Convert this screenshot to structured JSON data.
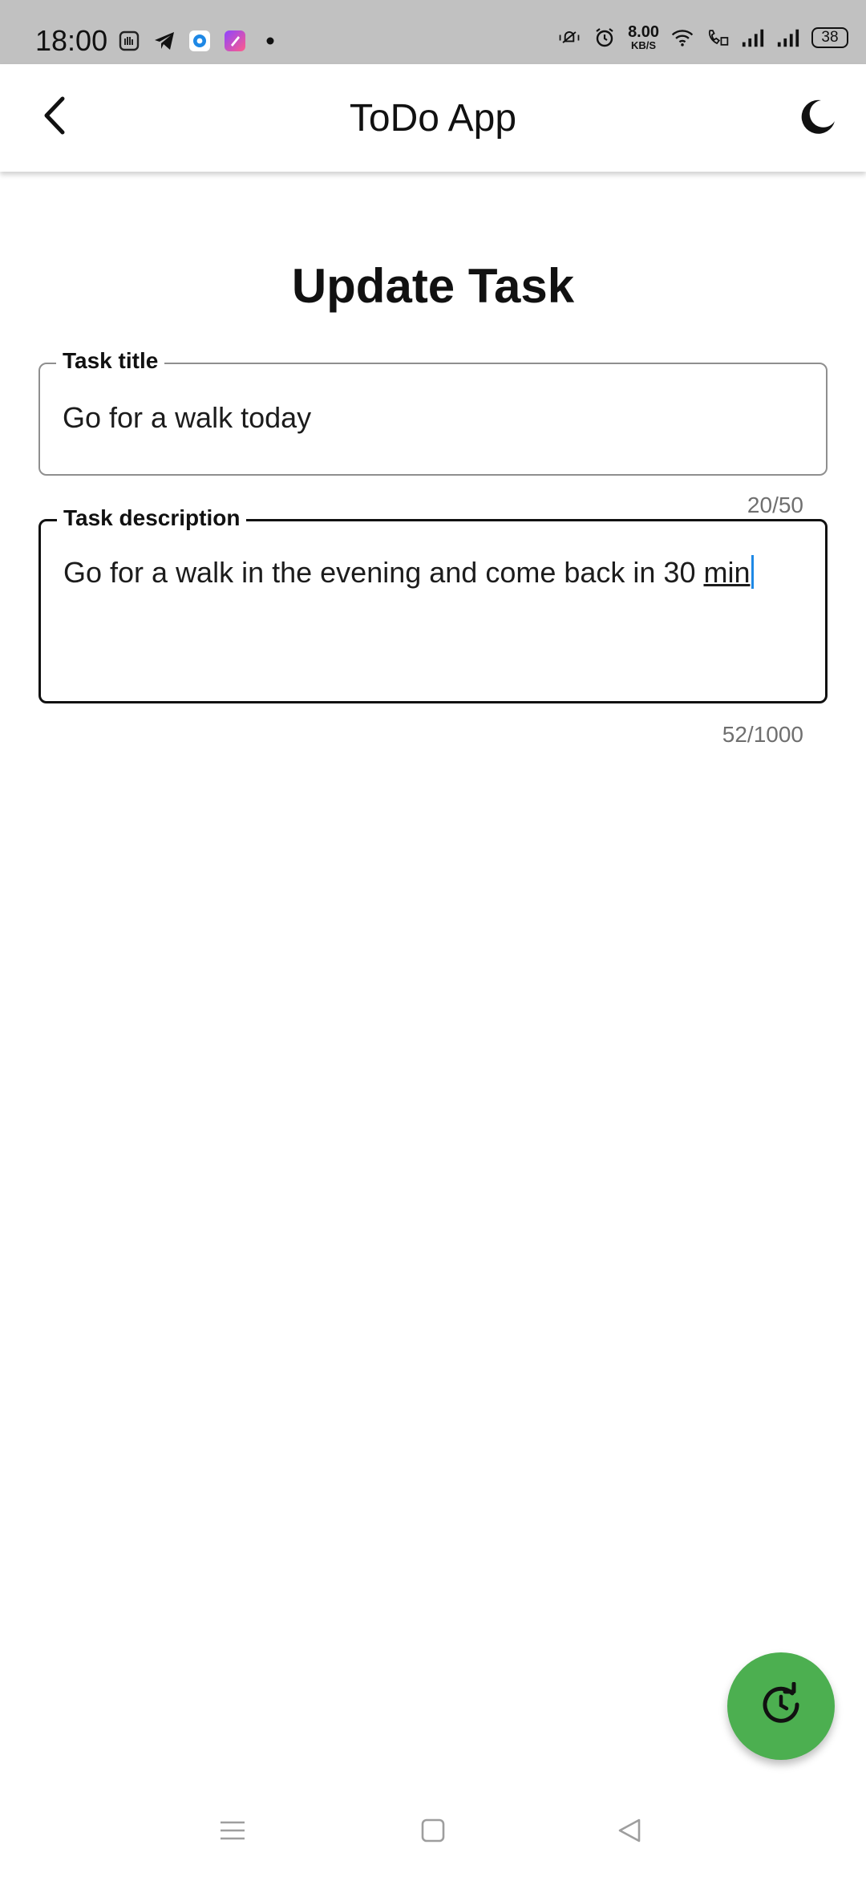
{
  "status_bar": {
    "time": "18:00",
    "speed_value": "8.00",
    "speed_unit": "KB/S",
    "battery": "38",
    "icons": [
      "hand-app-icon",
      "telegram-icon",
      "app-icon-blue",
      "app-icon-purple",
      "notification-dot-icon",
      "vibrate-mute-icon",
      "alarm-icon",
      "wifi-icon",
      "wifi-calling-icon",
      "signal-icon-1",
      "signal-icon-2",
      "battery-icon"
    ]
  },
  "app_bar": {
    "title": "ToDo App",
    "back_icon": "back-arrow-icon",
    "theme_icon": "moon-icon"
  },
  "form": {
    "heading": "Update Task",
    "title_field": {
      "label": "Task title",
      "value": "Go for a walk today",
      "counter": "20/50"
    },
    "description_field": {
      "label": "Task description",
      "value_prefix": "Go for a walk in the evening and come back in 30 ",
      "value_underlined": "min",
      "counter": "52/1000"
    }
  },
  "fab": {
    "icon": "update-icon",
    "color": "#4caf50"
  },
  "nav_bar": {
    "icons": [
      "menu-icon",
      "home-square-icon",
      "back-triangle-icon"
    ]
  },
  "colors": {
    "status_bar_bg": "#c1c1c1",
    "caret": "#1e88e5",
    "accent": "#4caf50"
  }
}
